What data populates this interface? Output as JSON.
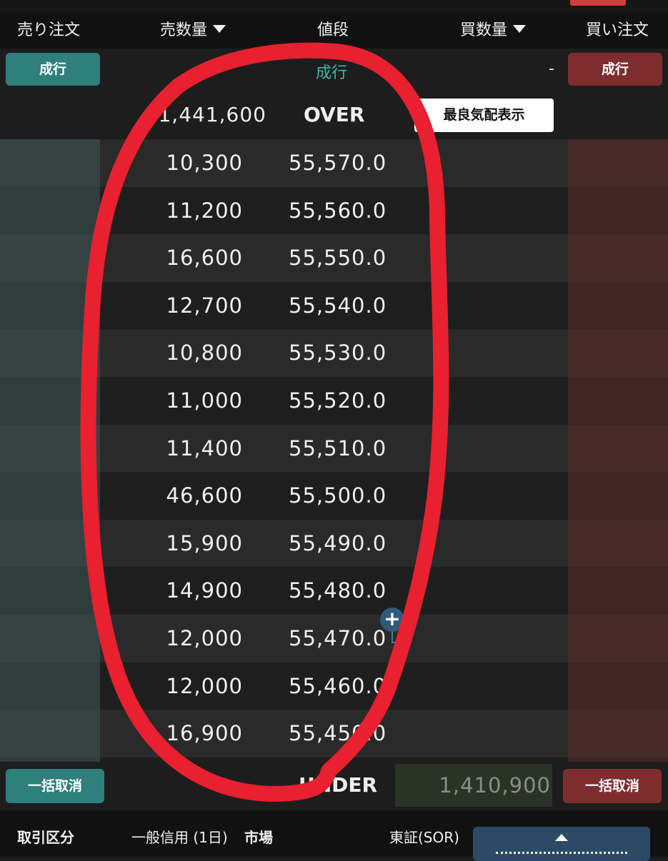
{
  "header": {
    "sell_order": "売り注文",
    "sell_qty": "売数量",
    "price": "値段",
    "buy_qty": "買数量",
    "buy_order": "買い注文"
  },
  "market": {
    "sell_button": "成行",
    "center_label": "成行",
    "buy_dash": "-",
    "buy_button": "成行"
  },
  "over": {
    "qty": "1,441,600",
    "label": "OVER",
    "best_quote_button": "最良気配表示"
  },
  "book": {
    "rows": [
      {
        "qty": "10,300",
        "price": "55,570.0"
      },
      {
        "qty": "11,200",
        "price": "55,560.0"
      },
      {
        "qty": "16,600",
        "price": "55,550.0"
      },
      {
        "qty": "12,700",
        "price": "55,540.0"
      },
      {
        "qty": "10,800",
        "price": "55,530.0"
      },
      {
        "qty": "11,000",
        "price": "55,520.0"
      },
      {
        "qty": "11,400",
        "price": "55,510.0"
      },
      {
        "qty": "46,600",
        "price": "55,500.0"
      },
      {
        "qty": "15,900",
        "price": "55,490.0"
      },
      {
        "qty": "14,900",
        "price": "55,480.0"
      },
      {
        "qty": "12,000",
        "price": "55,470.0"
      },
      {
        "qty": "12,000",
        "price": "55,460.0"
      },
      {
        "qty": "16,900",
        "price": "55,450.0"
      },
      {
        "qty": "",
        "price": ""
      }
    ],
    "plus_icon": "+"
  },
  "under": {
    "sell_cancel_all": "一括取消",
    "label": "UNDER",
    "qty": "1,410,900",
    "buy_cancel_all": "一括取消"
  },
  "footer": {
    "trade_type_label": "取引区分",
    "trade_type_value": "一般信用 (1日)",
    "market_label": "市場",
    "market_value": "東証(SOR)"
  },
  "colors": {
    "sell_accent": "#2f7f7c",
    "buy_accent": "#7e2d2f",
    "annotation": "#e8202f"
  }
}
